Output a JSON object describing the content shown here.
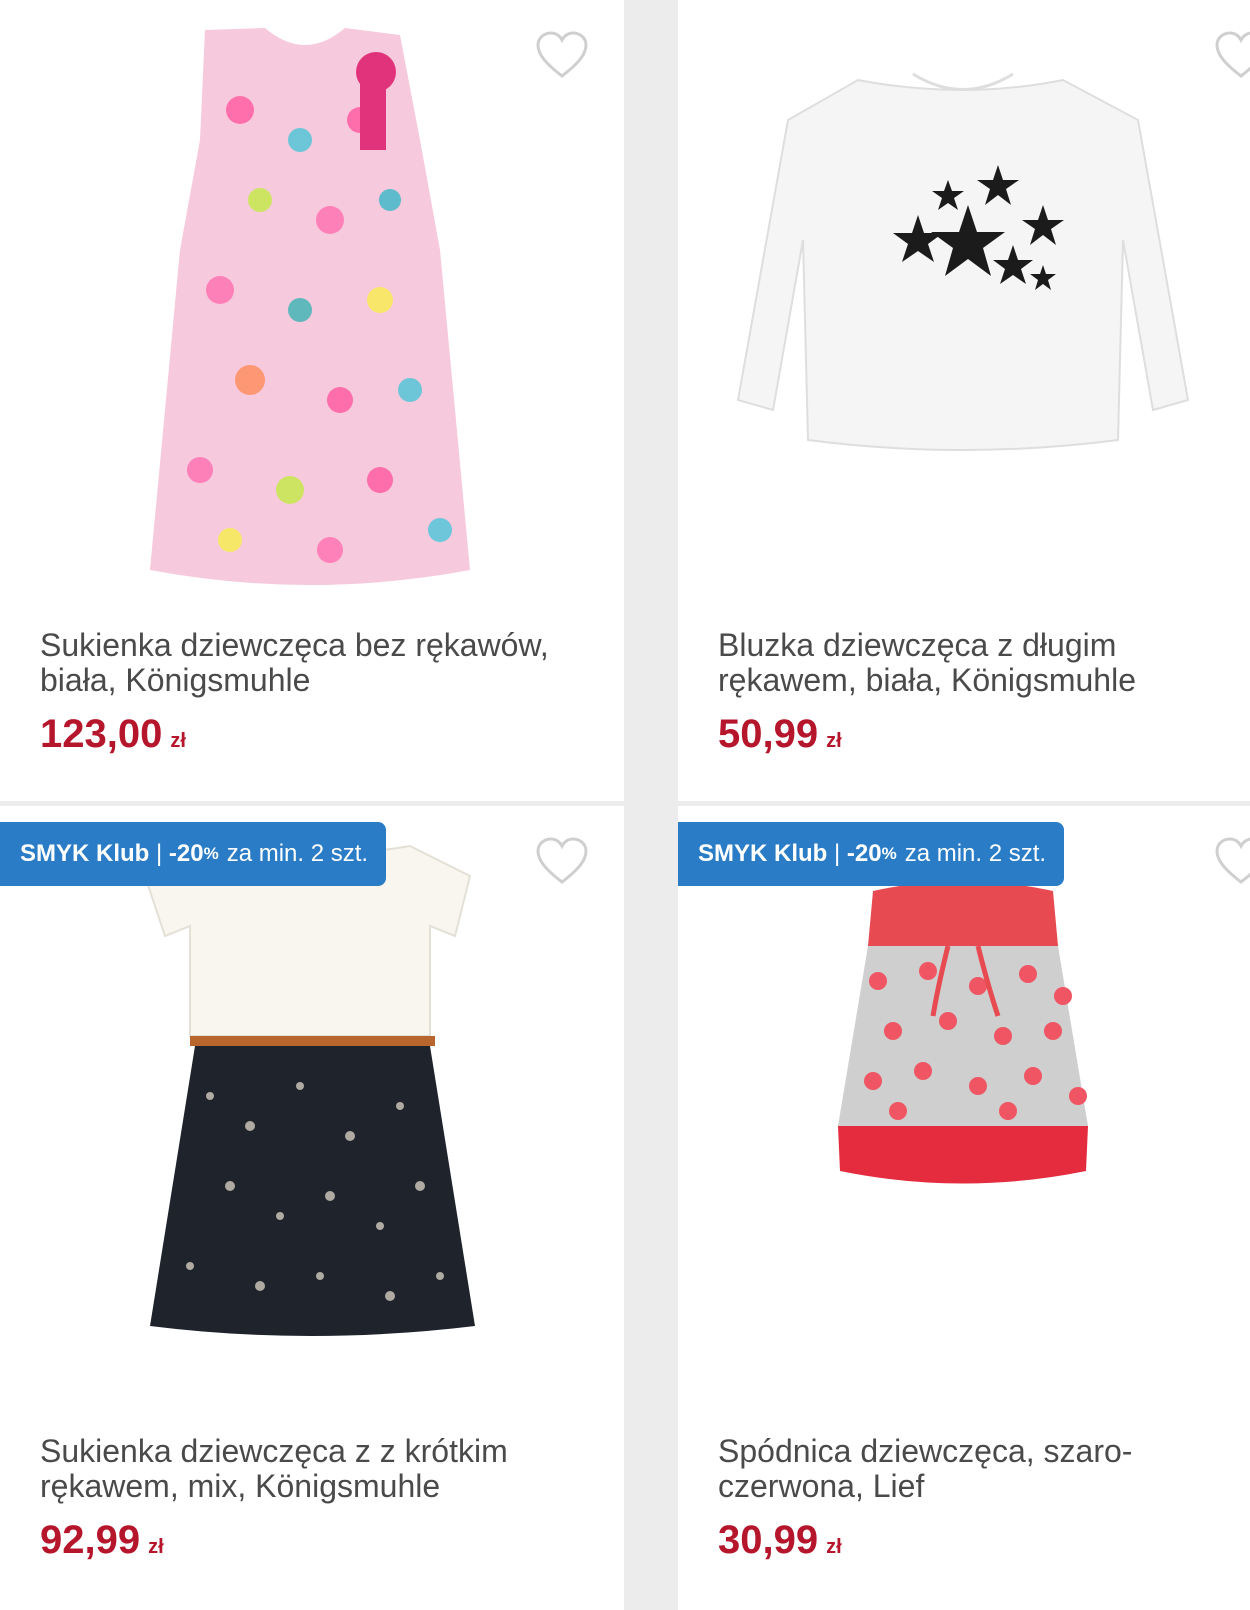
{
  "products": [
    {
      "title": "Sukienka dziewczęca bez rękawów, biała, Königsmuhle",
      "price": "123,00",
      "currency": "zł",
      "badge": null
    },
    {
      "title": "Bluzka dziewczęca z długim rękawem, biała, Königsmuhle",
      "price": "50,99",
      "currency": "zł",
      "badge": null
    },
    {
      "title": "Sukienka dziewczęca z z krótkim rękawem, mix, Königsmuhle",
      "price": "92,99",
      "currency": "zł",
      "badge": {
        "club": "SMYK Klub",
        "sep": "|",
        "discount": "-20",
        "pct": "%",
        "text": "za min. 2 szt."
      }
    },
    {
      "title": "Spódnica dziewczęca, szaro-czerwona, Lief",
      "price": "30,99",
      "currency": "zł",
      "badge": {
        "club": "SMYK Klub",
        "sep": "|",
        "discount": "-20",
        "pct": "%",
        "text": "za min. 2 szt."
      }
    }
  ],
  "colors": {
    "price": "#b5162c",
    "badge_bg": "#2a7cc6",
    "title": "#4a4a4a"
  },
  "icons": {
    "wishlist": "heart-outline-icon"
  }
}
